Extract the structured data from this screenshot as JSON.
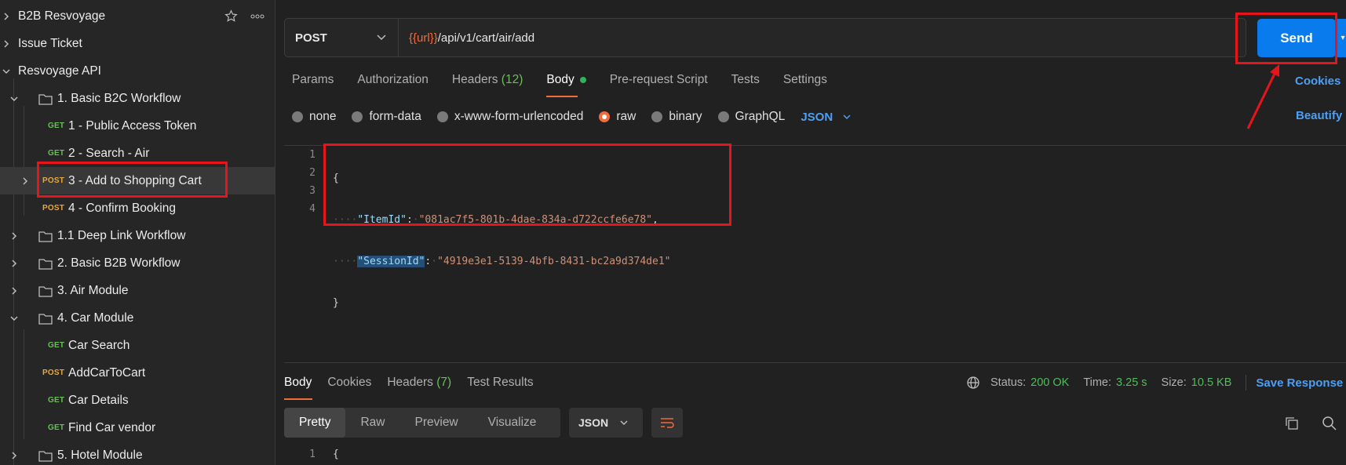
{
  "sidebar": {
    "rows": [
      {
        "label": "B2B Resvoyage",
        "method": ""
      },
      {
        "label": "Issue Ticket",
        "method": ""
      },
      {
        "label": "Resvoyage API",
        "method": ""
      },
      {
        "label": "1. Basic B2C Workflow",
        "method": ""
      },
      {
        "label": "1 - Public Access Token",
        "method": "GET"
      },
      {
        "label": "2 - Search - Air",
        "method": "GET"
      },
      {
        "label": "3 - Add to Shopping Cart",
        "method": "POST"
      },
      {
        "label": "4 - Confirm Booking",
        "method": "POST"
      },
      {
        "label": "1.1 Deep Link Workflow",
        "method": ""
      },
      {
        "label": "2. Basic B2B Workflow",
        "method": ""
      },
      {
        "label": "3. Air Module",
        "method": ""
      },
      {
        "label": "4. Car Module",
        "method": ""
      },
      {
        "label": "Car Search",
        "method": "GET"
      },
      {
        "label": "AddCarToCart",
        "method": "POST"
      },
      {
        "label": "Car Details",
        "method": "GET"
      },
      {
        "label": "Find Car vendor",
        "method": "GET"
      },
      {
        "label": "5. Hotel Module",
        "method": ""
      }
    ]
  },
  "request": {
    "method": "POST",
    "url_var": "{{url}}",
    "url_path": "/api/v1/cart/air/add",
    "send_label": "Send"
  },
  "tabs": [
    "Params",
    "Authorization",
    "Headers",
    "Body",
    "Pre-request Script",
    "Tests",
    "Settings"
  ],
  "headers_count": "(12)",
  "cookies_link": "Cookies",
  "beautify_link": "Beautify",
  "body_types": [
    "none",
    "form-data",
    "x-www-form-urlencoded",
    "raw",
    "binary",
    "GraphQL"
  ],
  "body_format": "JSON",
  "editor": {
    "line_numbers": [
      "1",
      "2",
      "3",
      "4"
    ],
    "open_brace": "{",
    "close_brace": "}",
    "item_key": "\"ItemId\"",
    "item_value": "\"081ac7f5-801b-4dae-834a-d722ccfe6e78\"",
    "session_key": "\"SessionId\"",
    "session_value": "\"4919e3e1-5139-4bfb-8431-bc2a9d374de1\""
  },
  "response": {
    "tabs": [
      "Body",
      "Cookies",
      "Headers",
      "Test Results"
    ],
    "headers_count": "(7)",
    "status_label": "Status:",
    "status_value": "200 OK",
    "time_label": "Time:",
    "time_value": "3.25 s",
    "size_label": "Size:",
    "size_value": "10.5 KB",
    "save_label": "Save Response",
    "views": [
      "Pretty",
      "Raw",
      "Preview",
      "Visualize"
    ],
    "format": "JSON",
    "line1": "1",
    "line1_text": "{"
  },
  "colors": {
    "accent": "#f26b3a",
    "send": "#097bed",
    "get": "#6bbd5b",
    "post": "#e7a73c",
    "annotation": "#e8141c"
  }
}
